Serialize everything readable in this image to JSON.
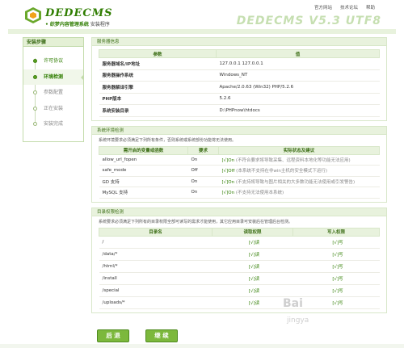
{
  "header": {
    "brand": "DEDECMS",
    "tagline_hl": "• 织梦内容管理系统",
    "tagline_rest": " 安装程序",
    "version": "DEDECMS V5.3 UTF8",
    "links": [
      "官方网站",
      "技术论坛",
      "帮助"
    ]
  },
  "sidebar": {
    "title": "安装步骤",
    "steps": [
      {
        "label": "许可协议",
        "state": "done"
      },
      {
        "label": "环境检测",
        "state": "active"
      },
      {
        "label": "参数配置",
        "state": "todo"
      },
      {
        "label": "正在安装",
        "state": "todo"
      },
      {
        "label": "安装完成",
        "state": "todo"
      }
    ]
  },
  "server_info": {
    "title": "服务器信息",
    "headers": [
      "参数",
      "值"
    ],
    "rows": [
      [
        "服务器域名/IP地址",
        "127.0.0.1 127.0.0.1"
      ],
      [
        "服务器操作系统",
        "Windows_NT"
      ],
      [
        "服务器解译引擎",
        "Apache/2.0.63 (Win32) PHP/5.2.6"
      ],
      [
        "PHP版本",
        "5.2.6"
      ],
      [
        "系统安装目录",
        "D:\\PHPnow\\htdocs"
      ]
    ]
  },
  "env_check": {
    "title": "系统环境检测",
    "note": "系统环境要求必须满足下列所有条件，否则系统或系统部份功能将无法使用。",
    "headers": [
      "需开启的变量或函数",
      "要求",
      "实际状态及建议"
    ],
    "rows": [
      [
        "allow_url_fopen",
        "On",
        "[√]On",
        " (不符合要求将导致采集、远程资料本地化等功能无法应用)"
      ],
      [
        "safe_mode",
        "Off",
        "[√]Off",
        " (本系统不支持在非win主机的安全模式下运行)"
      ],
      [
        "GD 支持",
        "On",
        "[√]On",
        " (不支持将导致与图片相关的大多数功能无法使用或引发警告)"
      ],
      [
        "MySQL 支持",
        "On",
        "[√]On",
        " (不支持无法使用本系统)"
      ]
    ]
  },
  "dir_check": {
    "title": "目录权限检测",
    "note": "系统要求必须满足下列所有的目录权限全部可读写的需求才能使用，其它应用目录可安装后在管理后台检测。",
    "headers": [
      "目录名",
      "读取权限",
      "写入权限"
    ],
    "rows": [
      [
        "/",
        "[√]读",
        "[√]写"
      ],
      [
        "/data/*",
        "[√]读",
        "[√]写"
      ],
      [
        "/html/*",
        "[√]读",
        "[√]写"
      ],
      [
        "/install",
        "[√]读",
        "[√]写"
      ],
      [
        "/special",
        "[√]读",
        "[√]写"
      ],
      [
        "/uploads/*",
        "[√]读",
        "[√]写"
      ]
    ]
  },
  "buttons": {
    "back": "后 退",
    "next": "继 续"
  },
  "watermark": {
    "line1": "Bai",
    "line2": "jingya"
  }
}
